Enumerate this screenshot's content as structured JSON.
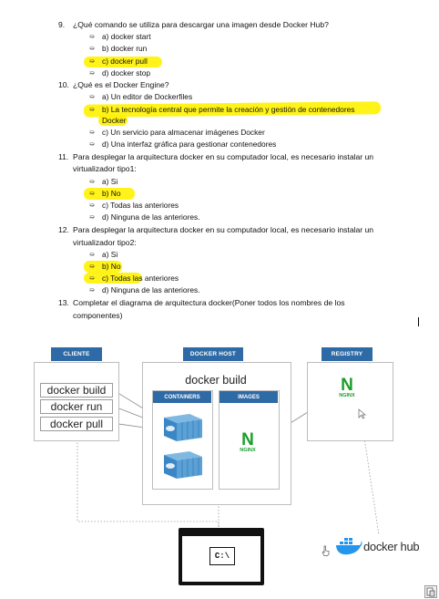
{
  "questions": [
    {
      "num": "9.",
      "text": "¿Qué comando se utiliza para descargar una imagen desde Docker Hub?",
      "options": [
        "a) docker start",
        "b) docker run",
        "c) docker pull",
        "d) docker stop"
      ]
    },
    {
      "num": "10.",
      "text": "¿Qué es el Docker Engine?",
      "options": [
        "a) Un editor de Dockerfiles",
        "b) La tecnología central que permite la creación y gestión de contenedores",
        "c) Un servicio para almacenar imágenes Docker",
        "d) Una interfaz gráfica para gestionar contenedores"
      ],
      "option_b_continuation": "Docker"
    },
    {
      "num": "11.",
      "text": "Para desplegar la arquitectura docker en su computador local, es necesario instalar un",
      "continuation": "virtualizador tipo1:",
      "options": [
        "a) Si",
        "b) No",
        "c) Todas las anteriores",
        "d) Ninguna de las anteriores."
      ]
    },
    {
      "num": "12.",
      "text": "Para desplegar la arquitectura docker en su computador local, es necesario instalar un",
      "continuation": "virtualizador tipo2:",
      "options": [
        "a) Si",
        "b) No",
        "c) Todas las anteriores",
        "d) Ninguna de las anteriores."
      ]
    },
    {
      "num": "13.",
      "text": "Completar el diagrama de arquitectura docker(Poner todos los nombres de los",
      "continuation": "componentes)"
    }
  ],
  "diagram": {
    "client_header": "CLIENTE",
    "host_header": "DOCKER HOST",
    "registry_header": "REGISTRY",
    "commands": [
      "docker build",
      "docker run",
      "docker pull"
    ],
    "host_title": "docker build",
    "containers_header": "CONTAINERS",
    "images_header": "IMAGES",
    "nginx_label": "NGINX",
    "terminal_prompt": "C:\\",
    "dockerhub_label": "docker hub",
    "colors": {
      "header_blue": "#2e6aa6",
      "highlight": "#fff200",
      "nginx_green": "#1a9e2a",
      "docker_blue": "#2496ed"
    }
  }
}
